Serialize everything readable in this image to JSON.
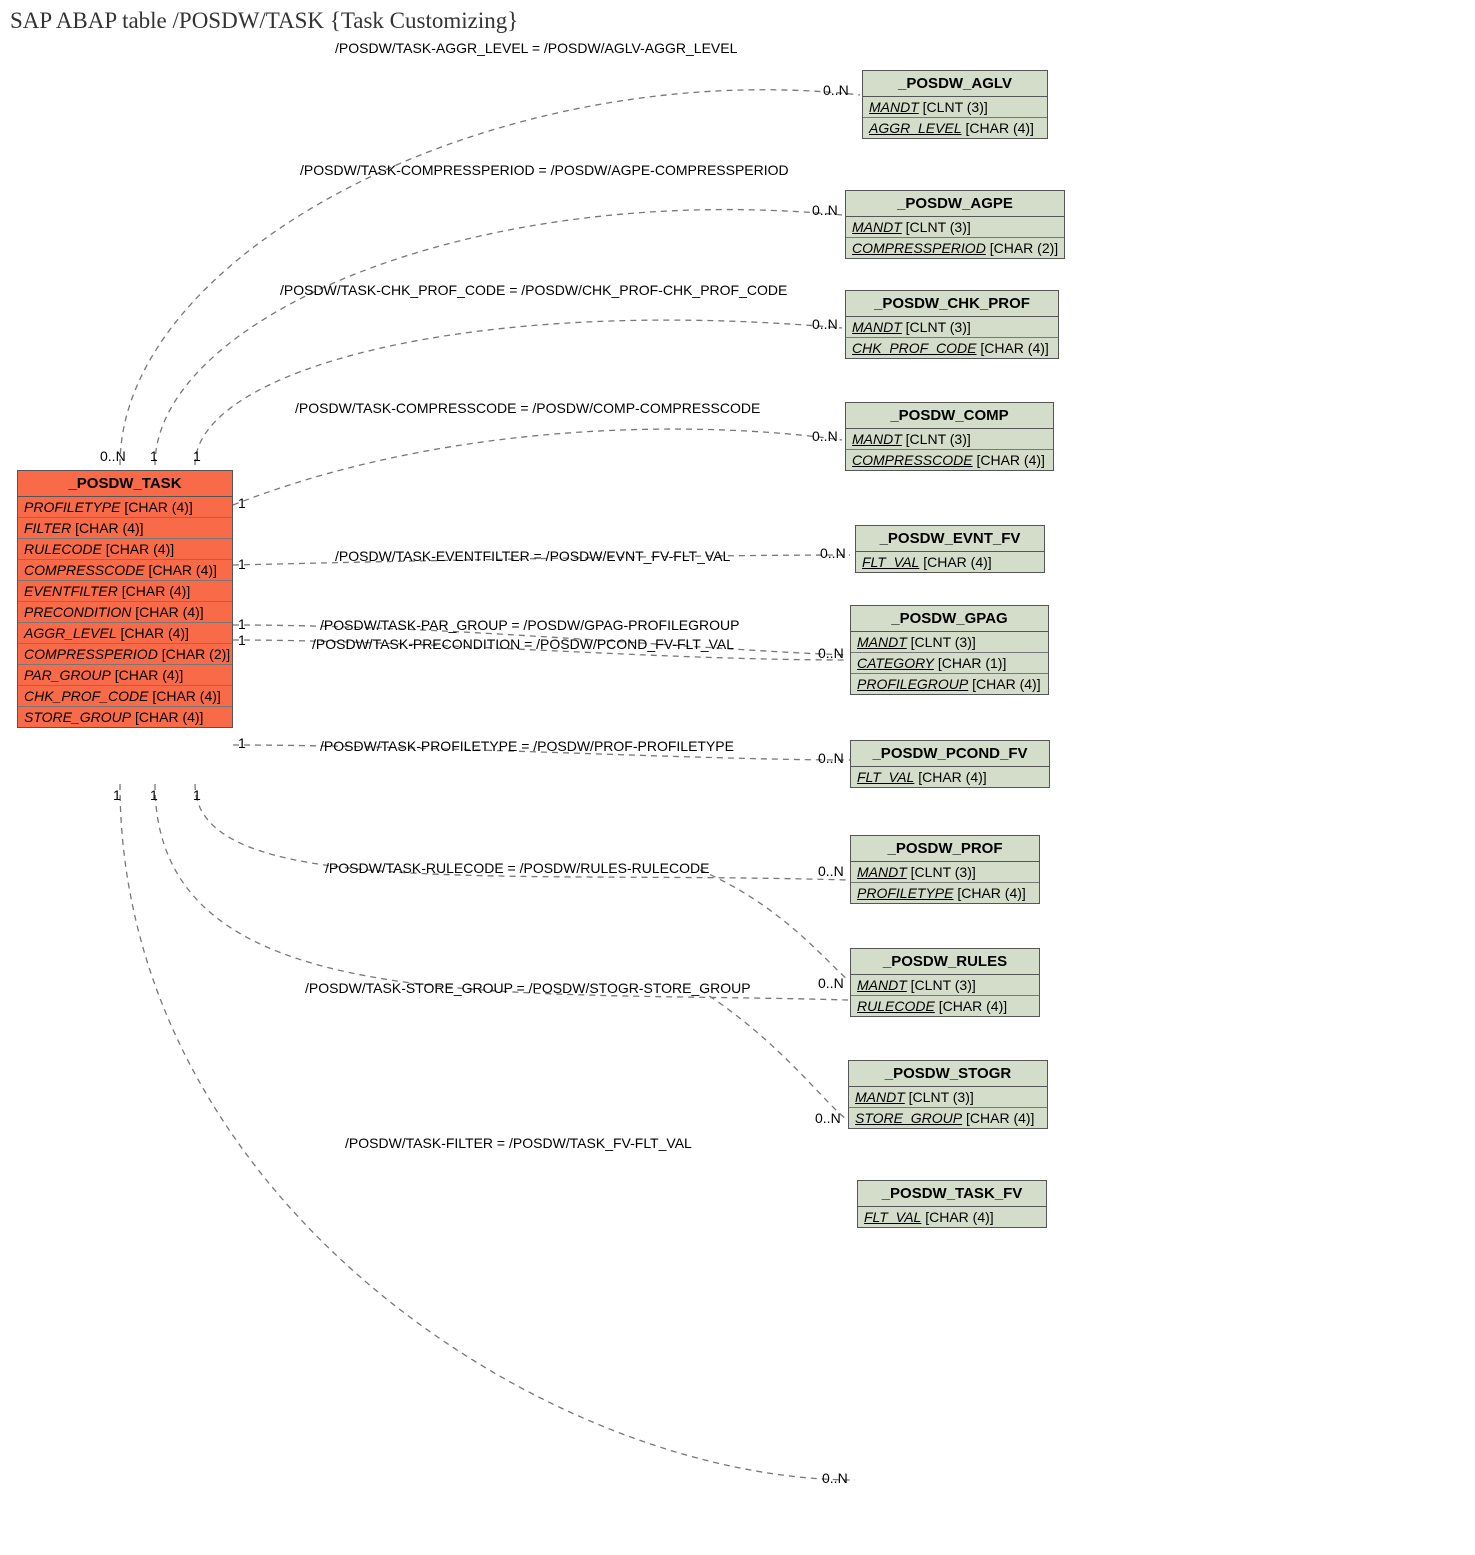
{
  "title": "SAP ABAP table /POSDW/TASK {Task Customizing}",
  "main_entity": {
    "name": "_POSDW_TASK",
    "fields": [
      {
        "name": "PROFILETYPE",
        "type": "[CHAR (4)]"
      },
      {
        "name": "FILTER",
        "type": "[CHAR (4)]"
      },
      {
        "name": "RULECODE",
        "type": "[CHAR (4)]"
      },
      {
        "name": "COMPRESSCODE",
        "type": "[CHAR (4)]"
      },
      {
        "name": "EVENTFILTER",
        "type": "[CHAR (4)]"
      },
      {
        "name": "PRECONDITION",
        "type": "[CHAR (4)]"
      },
      {
        "name": "AGGR_LEVEL",
        "type": "[CHAR (4)]"
      },
      {
        "name": "COMPRESSPERIOD",
        "type": "[CHAR (2)]"
      },
      {
        "name": "PAR_GROUP",
        "type": "[CHAR (4)]"
      },
      {
        "name": "CHK_PROF_CODE",
        "type": "[CHAR (4)]"
      },
      {
        "name": "STORE_GROUP",
        "type": "[CHAR (4)]"
      }
    ]
  },
  "relations": [
    {
      "label": "/POSDW/TASK-AGGR_LEVEL = /POSDW/AGLV-AGGR_LEVEL",
      "left_card": "0..N",
      "left_card2": "1",
      "right_card": "0..N",
      "target": {
        "name": "_POSDW_AGLV",
        "fields": [
          {
            "name": "MANDT",
            "type": "[CLNT (3)]"
          },
          {
            "name": "AGGR_LEVEL",
            "type": "[CHAR (4)]"
          }
        ]
      }
    },
    {
      "label": "/POSDW/TASK-COMPRESSPERIOD = /POSDW/AGPE-COMPRESSPERIOD",
      "left_card": "1",
      "right_card": "0..N",
      "target": {
        "name": "_POSDW_AGPE",
        "fields": [
          {
            "name": "MANDT",
            "type": "[CLNT (3)]"
          },
          {
            "name": "COMPRESSPERIOD",
            "type": "[CHAR (2)]"
          }
        ]
      }
    },
    {
      "label": "/POSDW/TASK-CHK_PROF_CODE = /POSDW/CHK_PROF-CHK_PROF_CODE",
      "left_card": "1",
      "right_card": "0..N",
      "target": {
        "name": "_POSDW_CHK_PROF",
        "fields": [
          {
            "name": "MANDT",
            "type": "[CLNT (3)]"
          },
          {
            "name": "CHK_PROF_CODE",
            "type": "[CHAR (4)]"
          }
        ]
      }
    },
    {
      "label": "/POSDW/TASK-COMPRESSCODE = /POSDW/COMP-COMPRESSCODE",
      "left_card": "1",
      "right_card": "0..N",
      "target": {
        "name": "_POSDW_COMP",
        "fields": [
          {
            "name": "MANDT",
            "type": "[CLNT (3)]"
          },
          {
            "name": "COMPRESSCODE",
            "type": "[CHAR (4)]"
          }
        ]
      }
    },
    {
      "label": "/POSDW/TASK-EVENTFILTER = /POSDW/EVNT_FV-FLT_VAL",
      "left_card": "1",
      "right_card": "0..N",
      "target": {
        "name": "_POSDW_EVNT_FV",
        "fields": [
          {
            "name": "FLT_VAL",
            "type": "[CHAR (4)]"
          }
        ]
      }
    },
    {
      "label": "/POSDW/TASK-PAR_GROUP = /POSDW/GPAG-PROFILEGROUP",
      "left_card": "1",
      "right_card": "0..N",
      "target": {
        "name": "_POSDW_GPAG",
        "fields": [
          {
            "name": "MANDT",
            "type": "[CLNT (3)]"
          },
          {
            "name": "CATEGORY",
            "type": "[CHAR (1)]"
          },
          {
            "name": "PROFILEGROUP",
            "type": "[CHAR (4)]"
          }
        ]
      }
    },
    {
      "label": "/POSDW/TASK-PRECONDITION = /POSDW/PCOND_FV-FLT_VAL",
      "left_card": "1",
      "right_card": "0..N",
      "target": {
        "name": "_POSDW_PCOND_FV",
        "fields": [
          {
            "name": "FLT_VAL",
            "type": "[CHAR (4)]"
          }
        ]
      }
    },
    {
      "label": "/POSDW/TASK-PROFILETYPE = /POSDW/PROF-PROFILETYPE",
      "left_card": "1",
      "right_card": "0..N",
      "target": {
        "name": "_POSDW_PROF",
        "fields": [
          {
            "name": "MANDT",
            "type": "[CLNT (3)]"
          },
          {
            "name": "PROFILETYPE",
            "type": "[CHAR (4)]"
          }
        ]
      }
    },
    {
      "label": "/POSDW/TASK-RULECODE = /POSDW/RULES-RULECODE",
      "left_card": "1",
      "right_card": "0..N",
      "target": {
        "name": "_POSDW_RULES",
        "fields": [
          {
            "name": "MANDT",
            "type": "[CLNT (3)]"
          },
          {
            "name": "RULECODE",
            "type": "[CHAR (4)]"
          }
        ]
      }
    },
    {
      "label": "/POSDW/TASK-STORE_GROUP = /POSDW/STOGR-STORE_GROUP",
      "left_card": "1",
      "right_card": "0..N",
      "target": {
        "name": "_POSDW_STOGR",
        "fields": [
          {
            "name": "MANDT",
            "type": "[CLNT (3)]"
          },
          {
            "name": "STORE_GROUP",
            "type": "[CHAR (4)]"
          }
        ]
      }
    },
    {
      "label": "/POSDW/TASK-FILTER = /POSDW/TASK_FV-FLT_VAL",
      "left_card": "1",
      "right_card": "0..N",
      "target": {
        "name": "_POSDW_TASK_FV",
        "fields": [
          {
            "name": "FLT_VAL",
            "type": "[CHAR (4)]"
          }
        ]
      }
    }
  ]
}
